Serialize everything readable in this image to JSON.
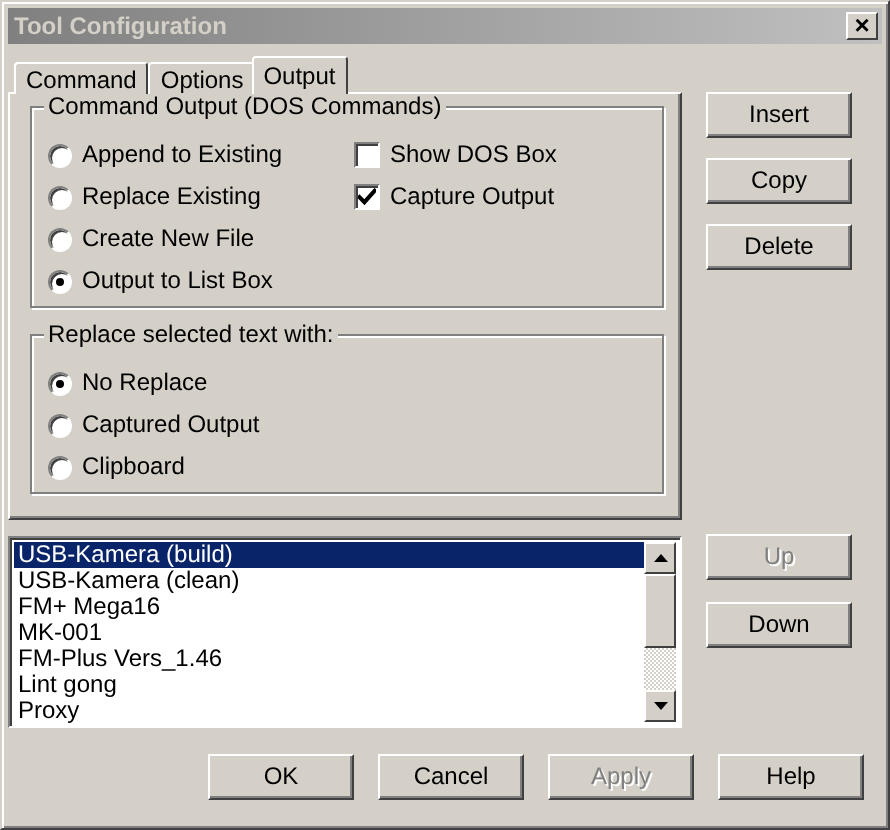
{
  "window": {
    "title": "Tool Configuration",
    "close_label": "×"
  },
  "tabs": [
    {
      "label": "Command",
      "selected": false
    },
    {
      "label": "Options",
      "selected": false
    },
    {
      "label": "Output",
      "selected": true
    }
  ],
  "output_group": {
    "title": "Command Output (DOS Commands)",
    "radios": [
      {
        "label": "Append to Existing",
        "selected": false
      },
      {
        "label": "Replace Existing",
        "selected": false
      },
      {
        "label": "Create New File",
        "selected": false
      },
      {
        "label": "Output to List Box",
        "selected": true
      }
    ],
    "checkboxes": [
      {
        "label": "Show DOS Box",
        "checked": false
      },
      {
        "label": "Capture Output",
        "checked": true
      }
    ]
  },
  "replace_group": {
    "title": "Replace selected text with:",
    "radios": [
      {
        "label": "No Replace",
        "selected": true
      },
      {
        "label": "Captured Output",
        "selected": false
      },
      {
        "label": "Clipboard",
        "selected": false
      }
    ]
  },
  "side_buttons": [
    {
      "label": "Insert",
      "disabled": false
    },
    {
      "label": "Copy",
      "disabled": false
    },
    {
      "label": "Delete",
      "disabled": false
    }
  ],
  "tools_list": {
    "items": [
      {
        "label": "USB-Kamera (build)",
        "selected": true
      },
      {
        "label": "USB-Kamera (clean)",
        "selected": false
      },
      {
        "label": "FM+ Mega16",
        "selected": false
      },
      {
        "label": "MK-001",
        "selected": false
      },
      {
        "label": "FM-Plus Vers_1.46",
        "selected": false
      },
      {
        "label": "Lint gong",
        "selected": false
      },
      {
        "label": "Proxy",
        "selected": false
      }
    ]
  },
  "move_buttons": [
    {
      "label": "Up",
      "disabled": true
    },
    {
      "label": "Down",
      "disabled": false
    }
  ],
  "buttons": [
    {
      "label": "OK",
      "disabled": false
    },
    {
      "label": "Cancel",
      "disabled": false
    },
    {
      "label": "Apply",
      "disabled": true
    },
    {
      "label": "Help",
      "disabled": false
    }
  ]
}
